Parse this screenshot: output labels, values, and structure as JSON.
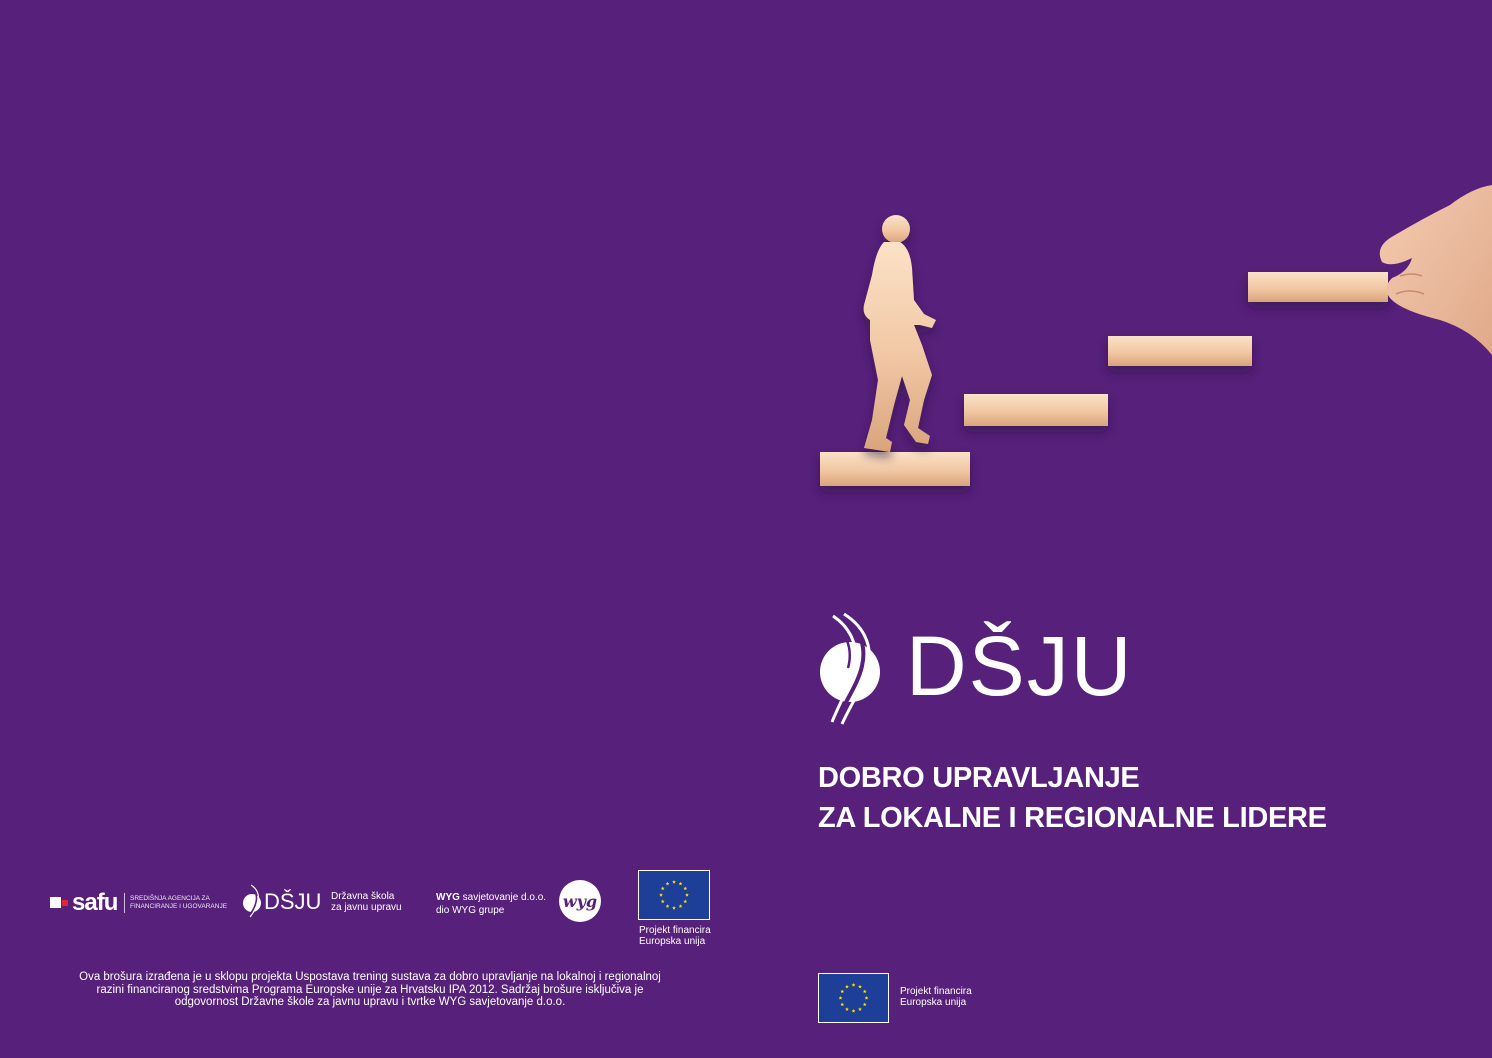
{
  "logo": {
    "wordmark": "DŠJU"
  },
  "title": {
    "line1": "DOBRO UPRAVLJANJE",
    "line2": "ZA LOKALNE I REGIONALNE LIDERE"
  },
  "partners": {
    "safu": {
      "name": "safu",
      "description_line1": "Središnja agencija za",
      "description_line2": "financiranje i ugovaranje"
    },
    "dsju": {
      "name": "DŠJU",
      "sub_line1": "Državna škola",
      "sub_line2": "za javnu upravu"
    },
    "wyg": {
      "name_bold": "WYG",
      "name_rest": "savjetovanje d.o.o.",
      "line2": "dio WYG grupe",
      "badge": "wyg"
    },
    "eu": {
      "caption_line1": "Projekt financira",
      "caption_line2": "Europska unija"
    }
  },
  "disclaimer": {
    "line1": "Ova brošura izrađena je u sklopu projekta Uspostava trening sustava za dobro upravljanje na lokalnoj i regionalnoj",
    "line2": "razini financiranog sredstvima Programa Europske unije za Hrvatsku IPA 2012. Sadržaj brošure isključiva je",
    "line3": "odgovornost Državne škole za javnu upravu i tvrtke WYG savjetovanje d.o.o."
  },
  "bottom_eu": {
    "caption_line1": "Projekt financira",
    "caption_line2": "Europska unija"
  },
  "colors": {
    "background": "#57207a",
    "eu_blue": "#1d3f97",
    "eu_star": "#ffdd00",
    "wood": "#f1c7a3"
  }
}
